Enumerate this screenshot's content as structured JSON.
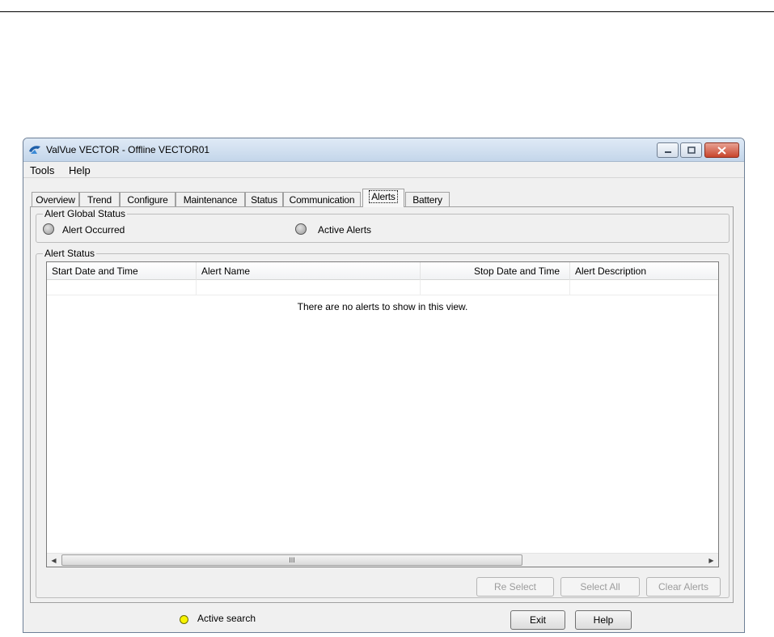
{
  "window": {
    "title": "ValVue VECTOR - Offline  VECTOR01"
  },
  "menu": {
    "items": [
      {
        "label": "Tools"
      },
      {
        "label": "Help"
      }
    ]
  },
  "tabs": [
    {
      "label": "Overview"
    },
    {
      "label": "Trend"
    },
    {
      "label": "Configure"
    },
    {
      "label": "Maintenance"
    },
    {
      "label": "Status"
    },
    {
      "label": "Communication"
    },
    {
      "label": "Alerts",
      "active": true
    },
    {
      "label": "Battery"
    }
  ],
  "alert_global_status": {
    "legend": "Alert Global Status",
    "alert_occurred_label": "Alert Occurred",
    "active_alerts_label": "Active Alerts"
  },
  "alert_status": {
    "legend": "Alert Status",
    "columns": [
      {
        "label": "Start Date and Time"
      },
      {
        "label": "Alert Name"
      },
      {
        "label": "Stop Date and Time"
      },
      {
        "label": "Alert Description"
      }
    ],
    "empty_text": "There are no alerts to show in this view.",
    "scroll_thumb_grip": "III"
  },
  "buttons": {
    "re_select": "Re Select",
    "select_all": "Select All",
    "clear_alerts": "Clear Alerts",
    "exit": "Exit",
    "help": "Help"
  },
  "statusbar": {
    "active_search": "Active search"
  },
  "colors": {
    "status_led": "#f7f300",
    "led_gray": "#9a9a9a",
    "close_button": "#c8452c"
  }
}
